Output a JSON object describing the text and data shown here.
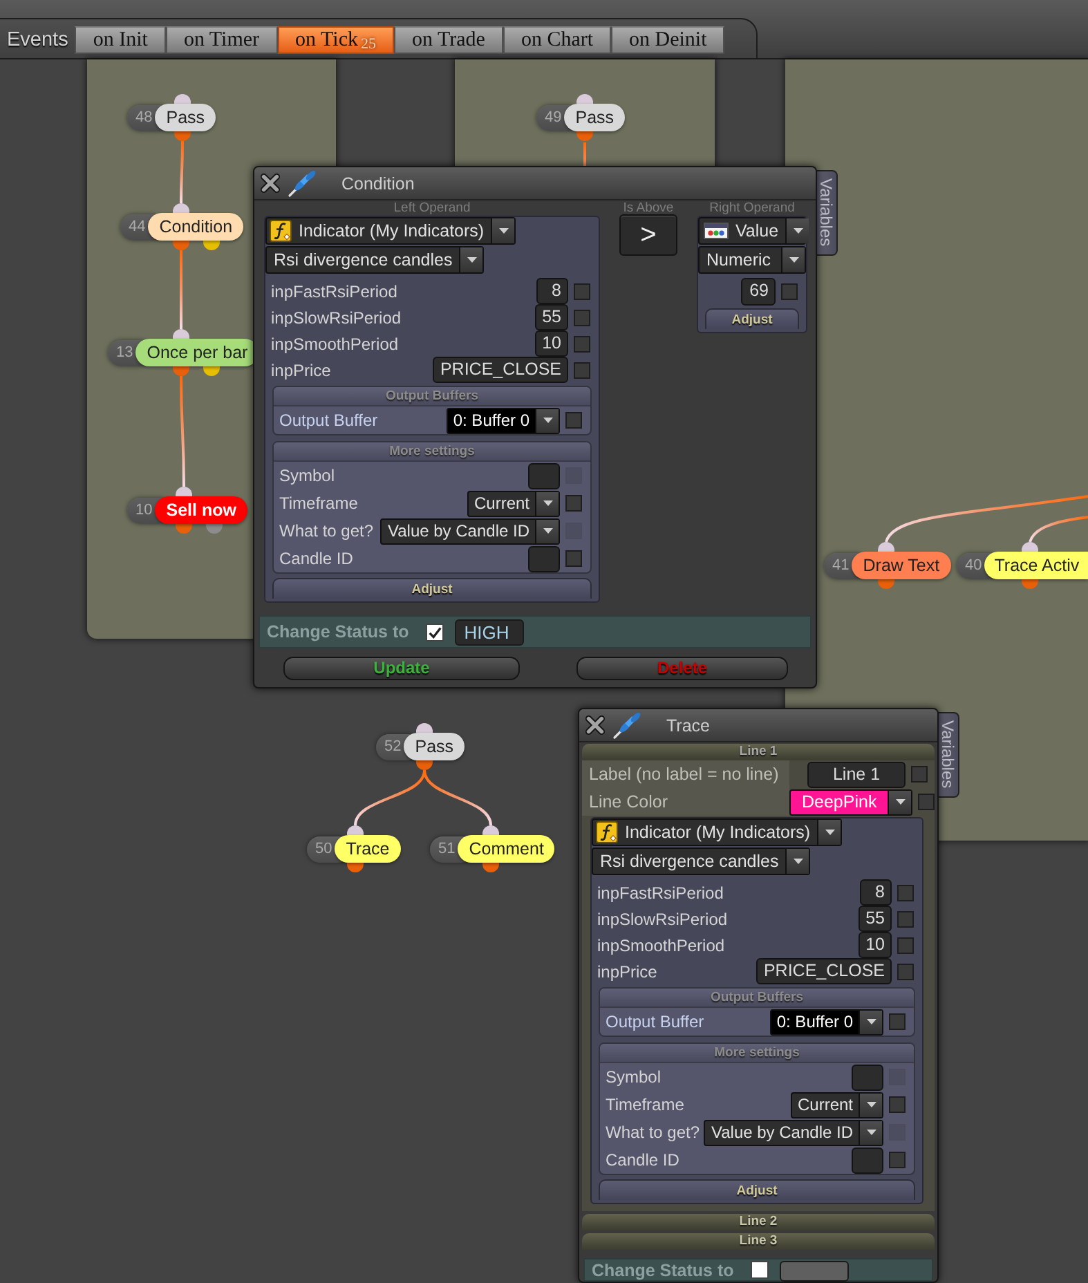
{
  "events_bar": {
    "label": "Events",
    "tabs": [
      {
        "label": "on Init",
        "selected": false
      },
      {
        "label": "on Timer",
        "selected": false
      },
      {
        "label": "on Tick",
        "count": "25",
        "selected": true
      },
      {
        "label": "on Trade",
        "selected": false
      },
      {
        "label": "on Chart",
        "selected": false
      },
      {
        "label": "on Deinit",
        "selected": false
      }
    ]
  },
  "flows": [
    {
      "id": "48",
      "label": "Pass",
      "color": "#d8d8d8",
      "outlets": [
        {
          "color": "#e8600a"
        }
      ],
      "children": [
        {
          "id": "44",
          "label": "Condition",
          "color": "#ffdcb0",
          "outlets": [
            {
              "color": "#e8600a"
            },
            {
              "color": "#e6c000"
            }
          ],
          "children": [
            {
              "id": "13",
              "label": "Once per bar",
              "color": "#a6dc7a",
              "outlets": [
                {
                  "color": "#e8600a"
                },
                {
                  "color": "#e6c000"
                }
              ],
              "children": [
                {
                  "id": "10",
                  "label": "Sell now",
                  "color": "#ff0000",
                  "outlets": [
                    {
                      "color": "#e8600a"
                    },
                    {
                      "color": "#8c8c8c"
                    }
                  ]
                }
              ]
            }
          ]
        }
      ]
    },
    {
      "id": "49",
      "label": "Pass",
      "color": "#d8d8d8",
      "outlets": [
        {
          "color": "#e8600a"
        }
      ]
    },
    {
      "id": "41",
      "label": "Draw Text",
      "color": "#ff7f50",
      "outlets": [
        {
          "color": "#e8600a"
        }
      ]
    },
    {
      "id": "40",
      "label": "Trace Activ",
      "color": "#ffff66",
      "outlets": [
        {
          "color": "#e8600a"
        }
      ]
    },
    {
      "id": "52",
      "label": "Pass",
      "color": "#d8d8d8",
      "outlets": [
        {
          "color": "#e8600a"
        }
      ],
      "children": [
        {
          "id": "50",
          "label": "Trace",
          "color": "#ffff66",
          "outlets": [
            {
              "color": "#e8600a"
            }
          ]
        },
        {
          "id": "51",
          "label": "Comment",
          "color": "#ffff66",
          "outlets": [
            {
              "color": "#e8600a"
            }
          ]
        }
      ]
    }
  ],
  "dialogs": [
    {
      "kind": "condition",
      "title": "Condition",
      "side_tab": "Variables",
      "left_operand": {
        "caption": "Left Operand",
        "source": "Indicator (My Indicators)",
        "indicator": "Rsi divergence candles",
        "params": [
          {
            "name": "inpFastRsiPeriod",
            "value": "8",
            "checked": false
          },
          {
            "name": "inpSlowRsiPeriod",
            "value": "55",
            "checked": false
          },
          {
            "name": "inpSmoothPeriod",
            "value": "10",
            "checked": false
          },
          {
            "name": "inpPrice",
            "value": "PRICE_CLOSE",
            "checked": false
          }
        ],
        "sections": [
          {
            "title": "Output Buffers",
            "rows": [
              {
                "kind": "select",
                "name": "Output Buffer",
                "value": "0: Buffer 0",
                "checked": false,
                "disabled": false
              }
            ]
          },
          {
            "title": "More settings",
            "rows": [
              {
                "kind": "field",
                "name": "Symbol",
                "checked": false,
                "disabled": true
              },
              {
                "kind": "select",
                "name": "Timeframe",
                "value": "Current",
                "checked": false,
                "disabled": false
              },
              {
                "kind": "select",
                "name": "What to get?",
                "value": "Value by Candle ID",
                "checked": false,
                "disabled": true
              },
              {
                "kind": "field",
                "name": "Candle ID",
                "checked": false,
                "disabled": false
              }
            ]
          }
        ],
        "adjust": "Adjust"
      },
      "comparator": {
        "caption": "Is Above",
        "symbol": ">"
      },
      "right_operand": {
        "caption": "Right Operand",
        "source": "Value",
        "type": "Numeric",
        "value": "69",
        "checked": false,
        "adjust": "Adjust"
      },
      "change_status": {
        "label": "Change Status to",
        "checked": true,
        "value": "HIGH"
      },
      "buttons": [
        {
          "kind": "update",
          "label": "Update"
        },
        {
          "kind": "delete",
          "label": "Delete"
        }
      ]
    },
    {
      "kind": "trace",
      "title": "Trace",
      "side_tab": "Variables",
      "lines": [
        {
          "title": "Line 1",
          "expanded": true,
          "label_row": {
            "label": "Label (no label = no line)",
            "value": "Line 1",
            "checked": false
          },
          "color_row": {
            "label": "Line Color",
            "value": "DeepPink",
            "color": "#ff1493",
            "checked": false
          },
          "operand": {
            "source": "Indicator (My Indicators)",
            "indicator": "Rsi divergence candles",
            "params": [
              {
                "name": "inpFastRsiPeriod",
                "value": "8",
                "checked": false
              },
              {
                "name": "inpSlowRsiPeriod",
                "value": "55",
                "checked": false
              },
              {
                "name": "inpSmoothPeriod",
                "value": "10",
                "checked": false
              },
              {
                "name": "inpPrice",
                "value": "PRICE_CLOSE",
                "checked": false
              }
            ],
            "sections": [
              {
                "title": "Output Buffers",
                "rows": [
                  {
                    "kind": "select",
                    "name": "Output Buffer",
                    "value": "0: Buffer 0",
                    "checked": false,
                    "disabled": false
                  }
                ]
              },
              {
                "title": "More settings",
                "rows": [
                  {
                    "kind": "field",
                    "name": "Symbol",
                    "checked": false,
                    "disabled": true
                  },
                  {
                    "kind": "select",
                    "name": "Timeframe",
                    "value": "Current",
                    "checked": false,
                    "disabled": false
                  },
                  {
                    "kind": "select",
                    "name": "What to get?",
                    "value": "Value by Candle ID",
                    "checked": false,
                    "disabled": true
                  },
                  {
                    "kind": "field",
                    "name": "Candle ID",
                    "checked": false,
                    "disabled": false
                  }
                ]
              }
            ],
            "adjust": "Adjust"
          }
        },
        {
          "title": "Line 2",
          "expanded": false
        },
        {
          "title": "Line 3",
          "expanded": false
        }
      ],
      "change_status": {
        "label": "Change Status to",
        "checked": false
      }
    }
  ]
}
